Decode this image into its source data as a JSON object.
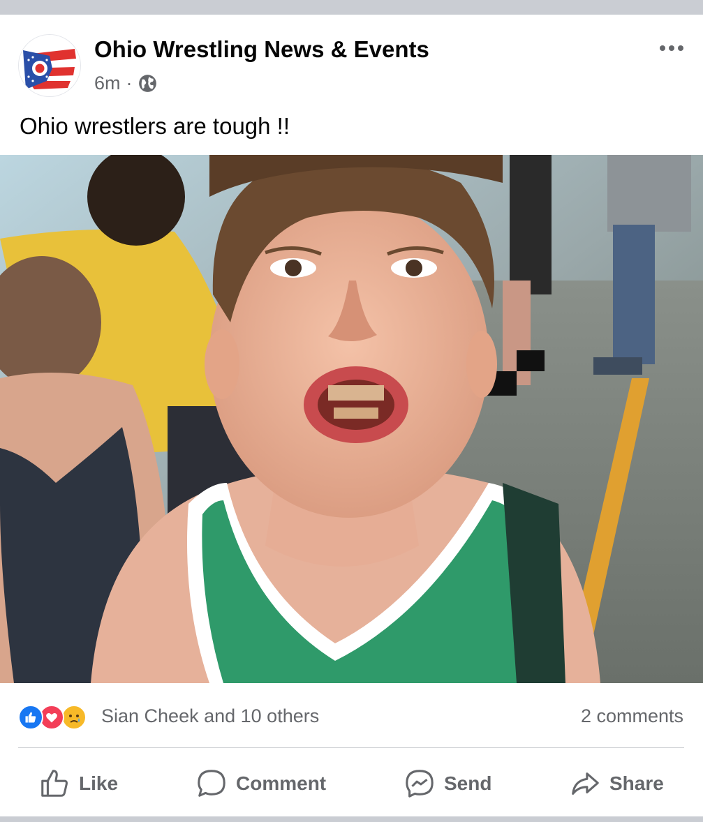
{
  "post": {
    "page_name": "Ohio Wrestling News & Events",
    "time": "6m",
    "separator": "·",
    "text": "Ohio wrestlers are tough !!"
  },
  "reactions": {
    "icons": [
      "like-icon",
      "love-icon",
      "care-icon"
    ],
    "summary": "Sian Cheek and 10 others",
    "comments": "2 comments"
  },
  "actions": {
    "like": "Like",
    "comment": "Comment",
    "send": "Send",
    "share": "Share"
  },
  "colors": {
    "like_blue": "#1877f2",
    "love_red": "#f33e58",
    "care_yellow": "#f7b928",
    "muted_text": "#65676b"
  }
}
